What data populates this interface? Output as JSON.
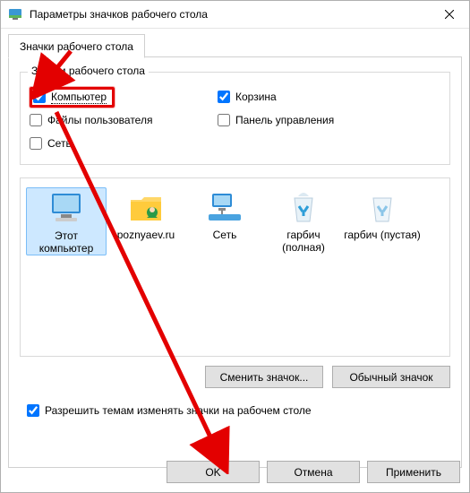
{
  "window": {
    "title": "Параметры значков рабочего стола"
  },
  "tab": {
    "label": "Значки рабочего стола"
  },
  "group": {
    "title": "Значки рабочего стола",
    "computer": "Компьютер",
    "recycle": "Корзина",
    "userfiles": "Файлы пользователя",
    "cpanel": "Панель управления",
    "network": "Сеть"
  },
  "preview": {
    "thispc": "Этот компьютер",
    "user": "poznyaev.ru",
    "network": "Сеть",
    "binfull": "гарбич (полная)",
    "binempty": "гарбич (пустая)"
  },
  "buttons": {
    "change": "Сменить значок...",
    "default": "Обычный значок",
    "ok": "OK",
    "cancel": "Отмена",
    "apply": "Применить"
  },
  "allow_themes": "Разрешить темам изменять значки на рабочем столе",
  "colors": {
    "accent_red": "#e30000"
  }
}
